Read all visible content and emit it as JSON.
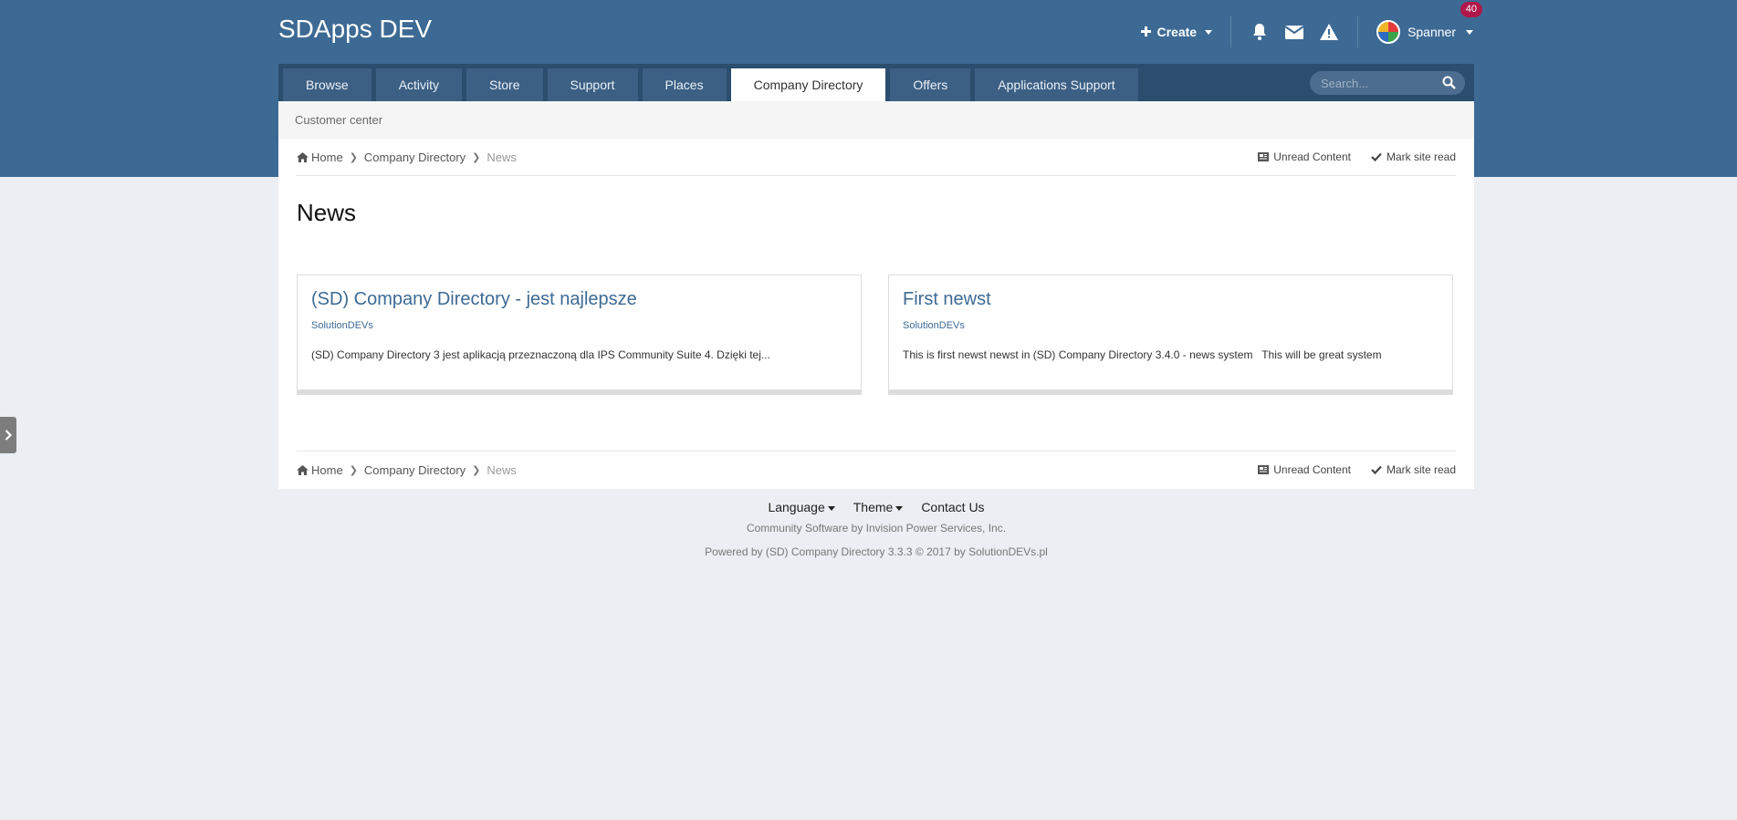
{
  "site": {
    "title": "SDApps DEV"
  },
  "userbar": {
    "create_label": "Create",
    "username": "Spanner",
    "notification_count": "40",
    "icons": [
      "bell-icon",
      "envelope-icon",
      "warning-icon"
    ]
  },
  "nav": {
    "tabs": [
      {
        "label": "Browse",
        "active": false
      },
      {
        "label": "Activity",
        "active": false
      },
      {
        "label": "Store",
        "active": false
      },
      {
        "label": "Support",
        "active": false
      },
      {
        "label": "Places",
        "active": false
      },
      {
        "label": "Company Directory",
        "active": true
      },
      {
        "label": "Offers",
        "active": false
      },
      {
        "label": "Applications Support",
        "active": false
      }
    ],
    "search_placeholder": "Search..."
  },
  "subnav": {
    "item": "Customer center"
  },
  "breadcrumb": {
    "home": "Home",
    "section": "Company Directory",
    "current": "News",
    "unread": "Unread Content",
    "mark_read": "Mark site read"
  },
  "page": {
    "title": "News"
  },
  "cards": [
    {
      "title": "(SD) Company Directory - jest najlepsze",
      "author": "SolutionDEVs",
      "excerpt": "(SD) Company Directory 3 jest aplikacją przeznaczoną dla IPS Community Suite 4. Dzięki tej..."
    },
    {
      "title": "First newst",
      "author": "SolutionDEVs",
      "excerpt": "This is first newst newst in (SD) Company Directory 3.4.0 - news system   This will be great system"
    }
  ],
  "footer": {
    "language": "Language",
    "theme": "Theme",
    "contact": "Contact Us",
    "line1": "Community Software by Invision Power Services, Inc.",
    "line2": "Powered by (SD) Company Directory 3.3.3 © 2017 by SolutionDEVs.pl"
  },
  "colors": {
    "header": "#3d6a94",
    "nav": "#2b4d6e",
    "tab": "#3c6084",
    "badge": "#b0174a",
    "link": "#3d6a94",
    "page_bg": "#ebeef2"
  }
}
